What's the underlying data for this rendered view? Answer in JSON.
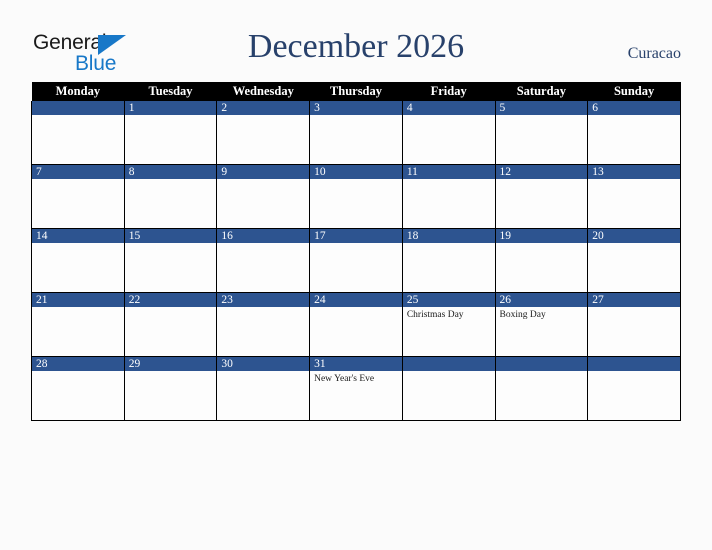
{
  "brand": {
    "name_part1": "General",
    "name_part2": "Blue",
    "triangle_icon": "blue-triangle-icon",
    "accent_color": "#1878c8"
  },
  "header": {
    "title": "December 2026",
    "locale": "Curacao",
    "title_color": "#28416b"
  },
  "calendar": {
    "weekday_headers": [
      "Monday",
      "Tuesday",
      "Wednesday",
      "Thursday",
      "Friday",
      "Saturday",
      "Sunday"
    ],
    "header_bg": "#000000",
    "daynum_bg": "#2d5490",
    "cell_bg": "#fdfdfd",
    "weeks": [
      [
        {
          "day": "",
          "events": []
        },
        {
          "day": "1",
          "events": []
        },
        {
          "day": "2",
          "events": []
        },
        {
          "day": "3",
          "events": []
        },
        {
          "day": "4",
          "events": []
        },
        {
          "day": "5",
          "events": []
        },
        {
          "day": "6",
          "events": []
        }
      ],
      [
        {
          "day": "7",
          "events": []
        },
        {
          "day": "8",
          "events": []
        },
        {
          "day": "9",
          "events": []
        },
        {
          "day": "10",
          "events": []
        },
        {
          "day": "11",
          "events": []
        },
        {
          "day": "12",
          "events": []
        },
        {
          "day": "13",
          "events": []
        }
      ],
      [
        {
          "day": "14",
          "events": []
        },
        {
          "day": "15",
          "events": []
        },
        {
          "day": "16",
          "events": []
        },
        {
          "day": "17",
          "events": []
        },
        {
          "day": "18",
          "events": []
        },
        {
          "day": "19",
          "events": []
        },
        {
          "day": "20",
          "events": []
        }
      ],
      [
        {
          "day": "21",
          "events": []
        },
        {
          "day": "22",
          "events": []
        },
        {
          "day": "23",
          "events": []
        },
        {
          "day": "24",
          "events": []
        },
        {
          "day": "25",
          "events": [
            "Christmas Day"
          ]
        },
        {
          "day": "26",
          "events": [
            "Boxing Day"
          ]
        },
        {
          "day": "27",
          "events": []
        }
      ],
      [
        {
          "day": "28",
          "events": []
        },
        {
          "day": "29",
          "events": []
        },
        {
          "day": "30",
          "events": []
        },
        {
          "day": "31",
          "events": [
            "New Year's Eve"
          ]
        },
        {
          "day": "",
          "events": []
        },
        {
          "day": "",
          "events": []
        },
        {
          "day": "",
          "events": []
        }
      ]
    ]
  }
}
